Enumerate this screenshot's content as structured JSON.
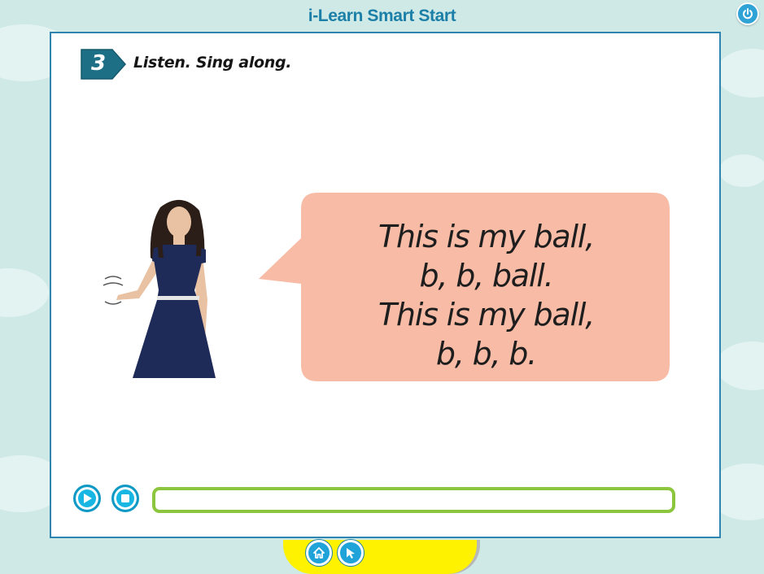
{
  "app": {
    "title": "i-Learn Smart Start"
  },
  "activity": {
    "number": "3",
    "instruction": "Listen. Sing along."
  },
  "song": {
    "lines": [
      "This is my ball,",
      "b, b, ball.",
      "This is my ball,",
      "b, b, b."
    ]
  },
  "player": {
    "progress": 0
  },
  "icons": {
    "power": "power-icon",
    "play": "play-icon",
    "stop": "stop-icon",
    "home": "home-icon",
    "pointer": "pointer-icon"
  },
  "colors": {
    "background": "#cfe9e6",
    "accent_blue": "#1fa3d8",
    "title_blue": "#1b7fa8",
    "badge_teal": "#1d6f86",
    "bubble": "#f8bca6",
    "progress_green": "#8cc63f",
    "footer_yellow": "#fff200"
  }
}
